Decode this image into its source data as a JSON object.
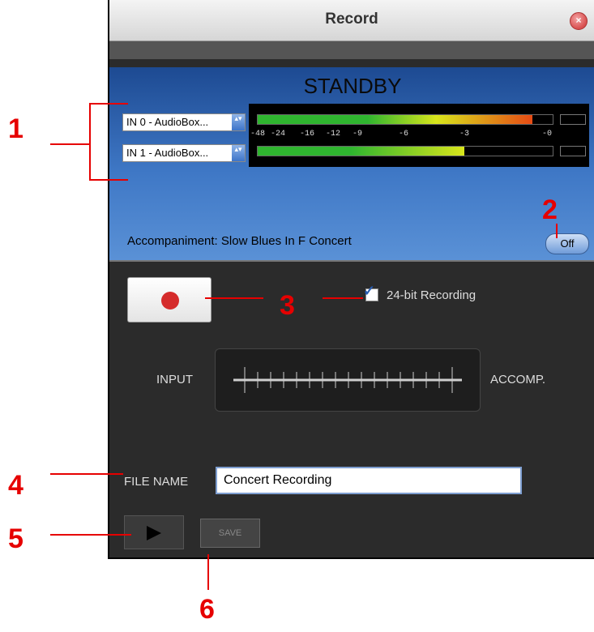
{
  "window": {
    "title": "Record",
    "close_glyph": "×"
  },
  "status": "STANDBY",
  "inputs": [
    {
      "label": "IN 0 - AudioBox...",
      "arrow": "▴▾",
      "level": 0.93
    },
    {
      "label": "IN 1 - AudioBox...",
      "arrow": "▴▾",
      "level": 0.7
    }
  ],
  "meter_scale": [
    "-48",
    "-24",
    "-16",
    "-12",
    "-9",
    "-6",
    "-3",
    "-0"
  ],
  "accompaniment": "Accompaniment: Slow Blues In F Concert",
  "accomp_toggle": "Off",
  "checkbox_label": "24-bit Recording",
  "checkbox_checked": true,
  "fader": {
    "left_label": "INPUT",
    "right_label": "ACCOMP."
  },
  "file_name": {
    "label": "FILE NAME",
    "value": "Concert Recording"
  },
  "save_label": "SAVE",
  "annotations": {
    "a1": "1",
    "a2": "2",
    "a3": "3",
    "a4": "4",
    "a5": "5",
    "a6": "6"
  },
  "colors": {
    "meter_green": "#2fb52f",
    "meter_yellow": "#d8e51b",
    "meter_red": "#e64a14",
    "annotation_red": "#e60000",
    "panel_blue": "#3f78c6"
  }
}
